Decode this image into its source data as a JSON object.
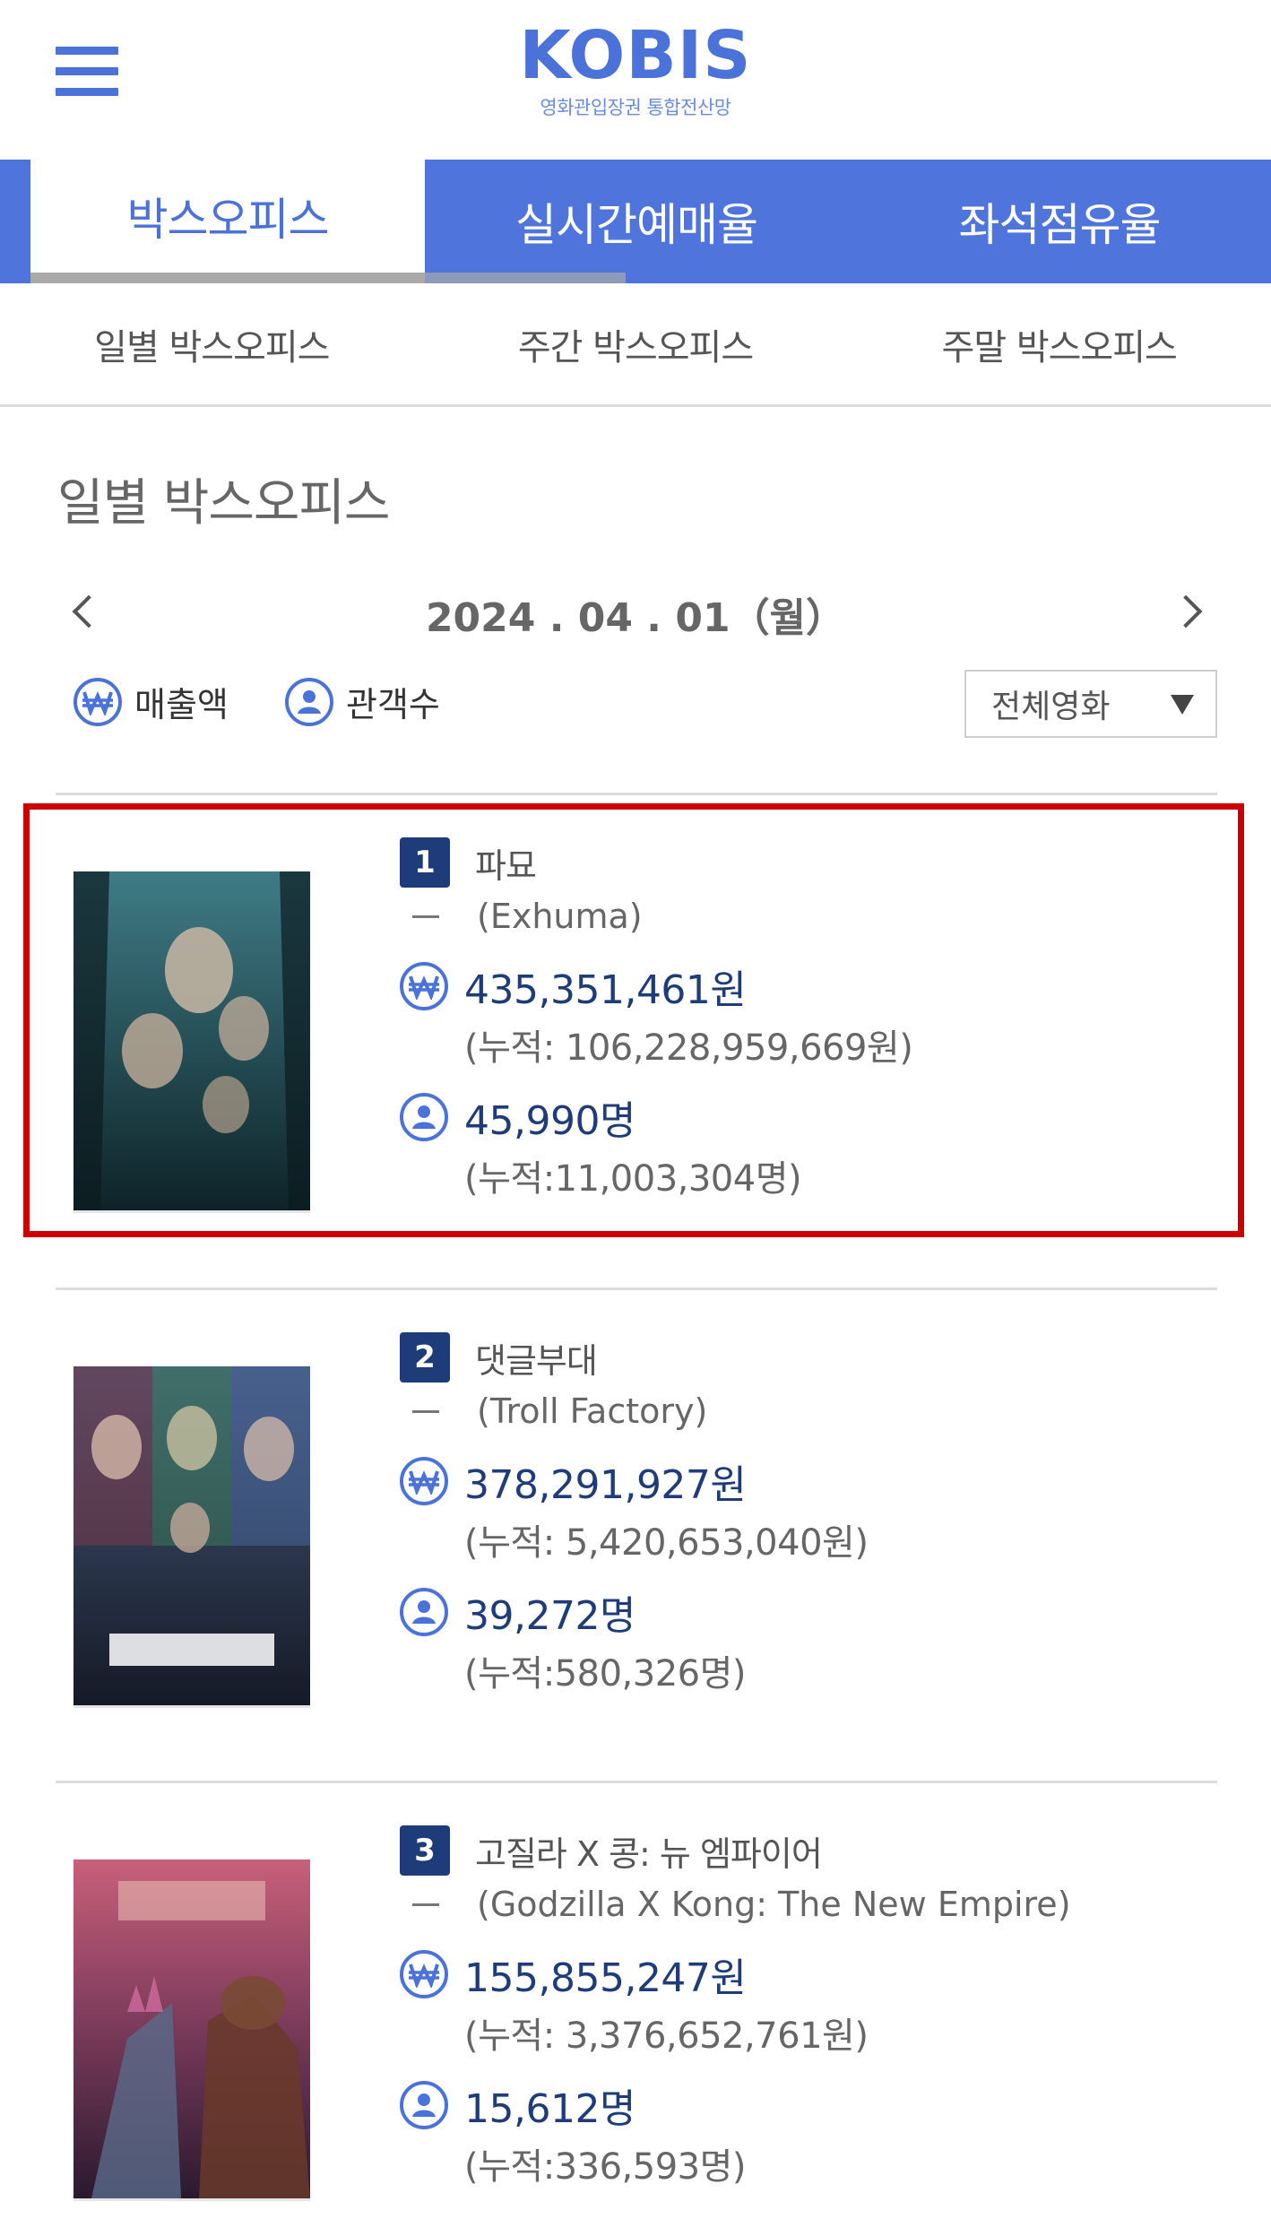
{
  "header": {
    "logo": "KOBIS",
    "logo_sub": "영화관입장권 통합전산망"
  },
  "main_tabs": [
    {
      "label": "박스오피스",
      "active": true
    },
    {
      "label": "실시간예매율",
      "active": false
    },
    {
      "label": "좌석점유율",
      "active": false
    }
  ],
  "sub_tabs": [
    {
      "label": "일별 박스오피스"
    },
    {
      "label": "주간 박스오피스"
    },
    {
      "label": "주말 박스오피스"
    }
  ],
  "section_title": "일별 박스오피스",
  "date": "2024 . 04 . 01（월）",
  "legend": {
    "sales_label": "매출액",
    "audience_label": "관객수"
  },
  "filter_select": {
    "selected": "전체영화"
  },
  "movies": [
    {
      "rank": "1",
      "title_ko": "파묘",
      "title_en": "(Exhuma)",
      "sales": "435,351,461원",
      "sales_cum": "(누적: 106,228,959,669원)",
      "audience": "45,990명",
      "audience_cum": "(누적:11,003,304명)",
      "poster_colors": [
        "#2f5e66",
        "#0f2a30"
      ],
      "highlighted": true
    },
    {
      "rank": "2",
      "title_ko": "댓글부대",
      "title_en": "(Troll Factory)",
      "sales": "378,291,927원",
      "sales_cum": "(누적: 5,420,653,040원)",
      "audience": "39,272명",
      "audience_cum": "(누적:580,326명)",
      "poster_colors": [
        "#3a4a6a",
        "#1a1e2c"
      ],
      "highlighted": false
    },
    {
      "rank": "3",
      "title_ko": "고질라 X 콩: 뉴 엠파이어",
      "title_en": "(Godzilla X Kong: The New Empire)",
      "sales": "155,855,247원",
      "sales_cum": "(누적: 3,376,652,761원)",
      "audience": "15,612명",
      "audience_cum": "(누적:336,593명)",
      "poster_colors": [
        "#b5546a",
        "#3a1f3a"
      ],
      "highlighted": false
    }
  ],
  "colors": {
    "brand_blue": "#4a72d9",
    "navy": "#1f3c7a",
    "highlight_red": "#cc0000"
  },
  "icons": {
    "menu": "hamburger-menu-icon",
    "sales": "won-currency-icon",
    "audience": "person-icon",
    "prev": "chevron-left-icon",
    "next": "chevron-right-icon",
    "dropdown": "triangle-down-icon"
  }
}
